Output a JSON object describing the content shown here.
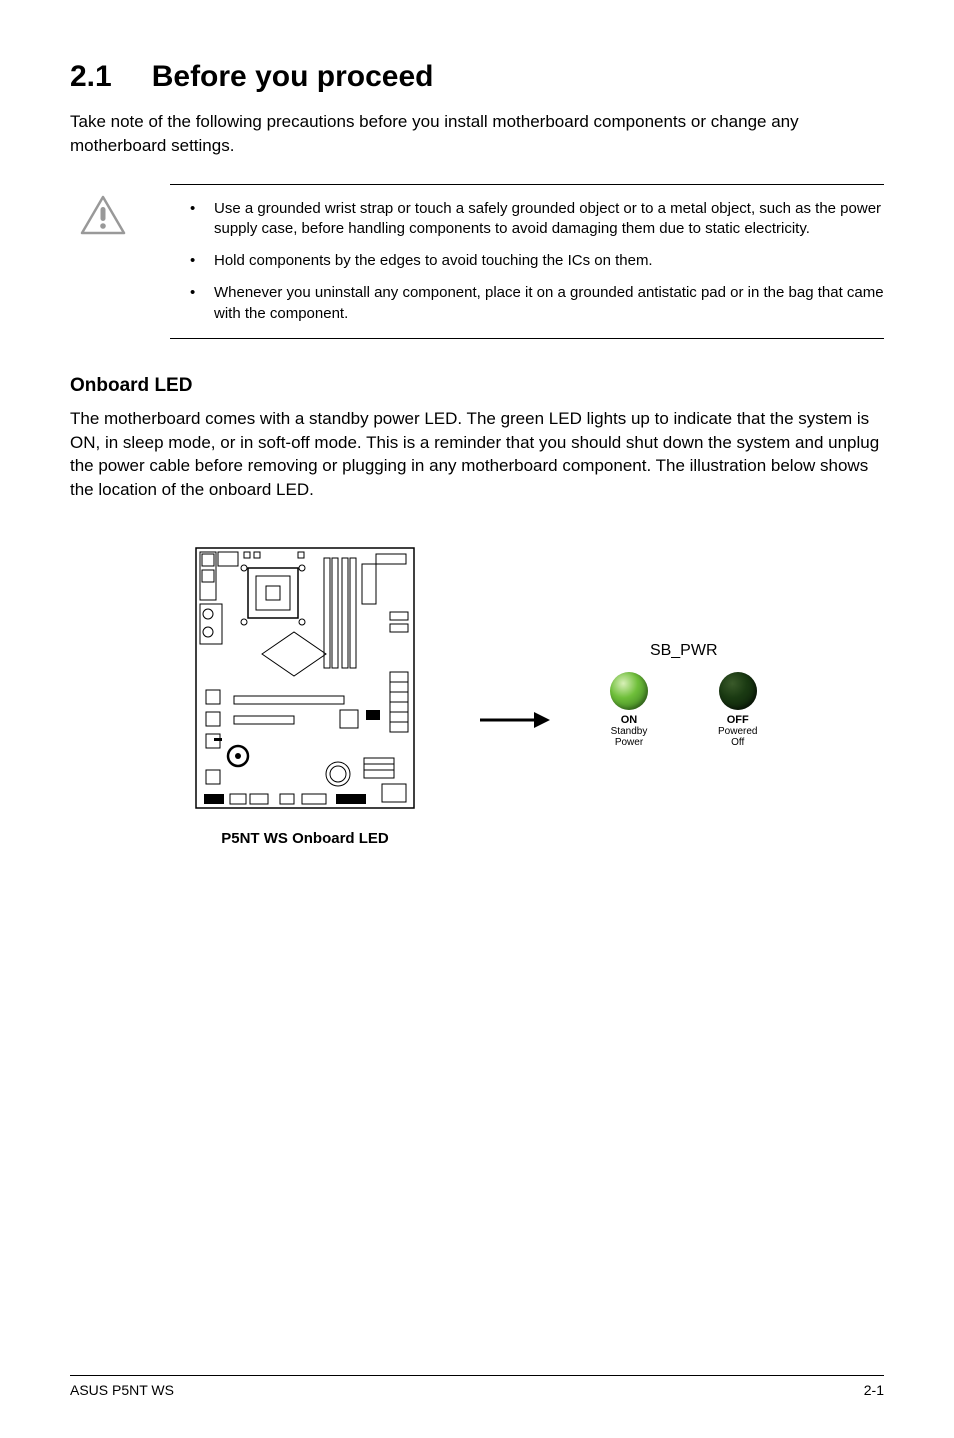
{
  "section": {
    "number": "2.1",
    "title": "Before you proceed"
  },
  "intro": "Take note of the following precautions before you install motherboard components or change any motherboard settings.",
  "cautions": [
    "Use a grounded wrist strap or touch  a safely grounded object or to a metal object, such as the power supply case, before handling components to avoid damaging them due to static electricity.",
    "Hold components by the edges to avoid touching the ICs on them.",
    "Whenever you uninstall any component, place it on a grounded antistatic pad or in the bag that came with the component."
  ],
  "onboard": {
    "heading": "Onboard LED",
    "body": "The motherboard comes with a standby power LED. The green LED lights up to indicate that the system is ON, in sleep mode, or in soft-off mode. This is a reminder that you should shut down the system and unplug the power cable before removing or plugging in any motherboard component. The illustration below shows the location of the onboard LED."
  },
  "diagram": {
    "board_caption": "P5NT WS Onboard LED",
    "sbpwr": "SB_PWR",
    "on_state": "ON",
    "on_desc1": "Standby",
    "on_desc2": "Power",
    "off_state": "OFF",
    "off_desc1": "Powered",
    "off_desc2": "Off"
  },
  "footer": {
    "left": "ASUS P5NT WS",
    "right": "2-1"
  }
}
